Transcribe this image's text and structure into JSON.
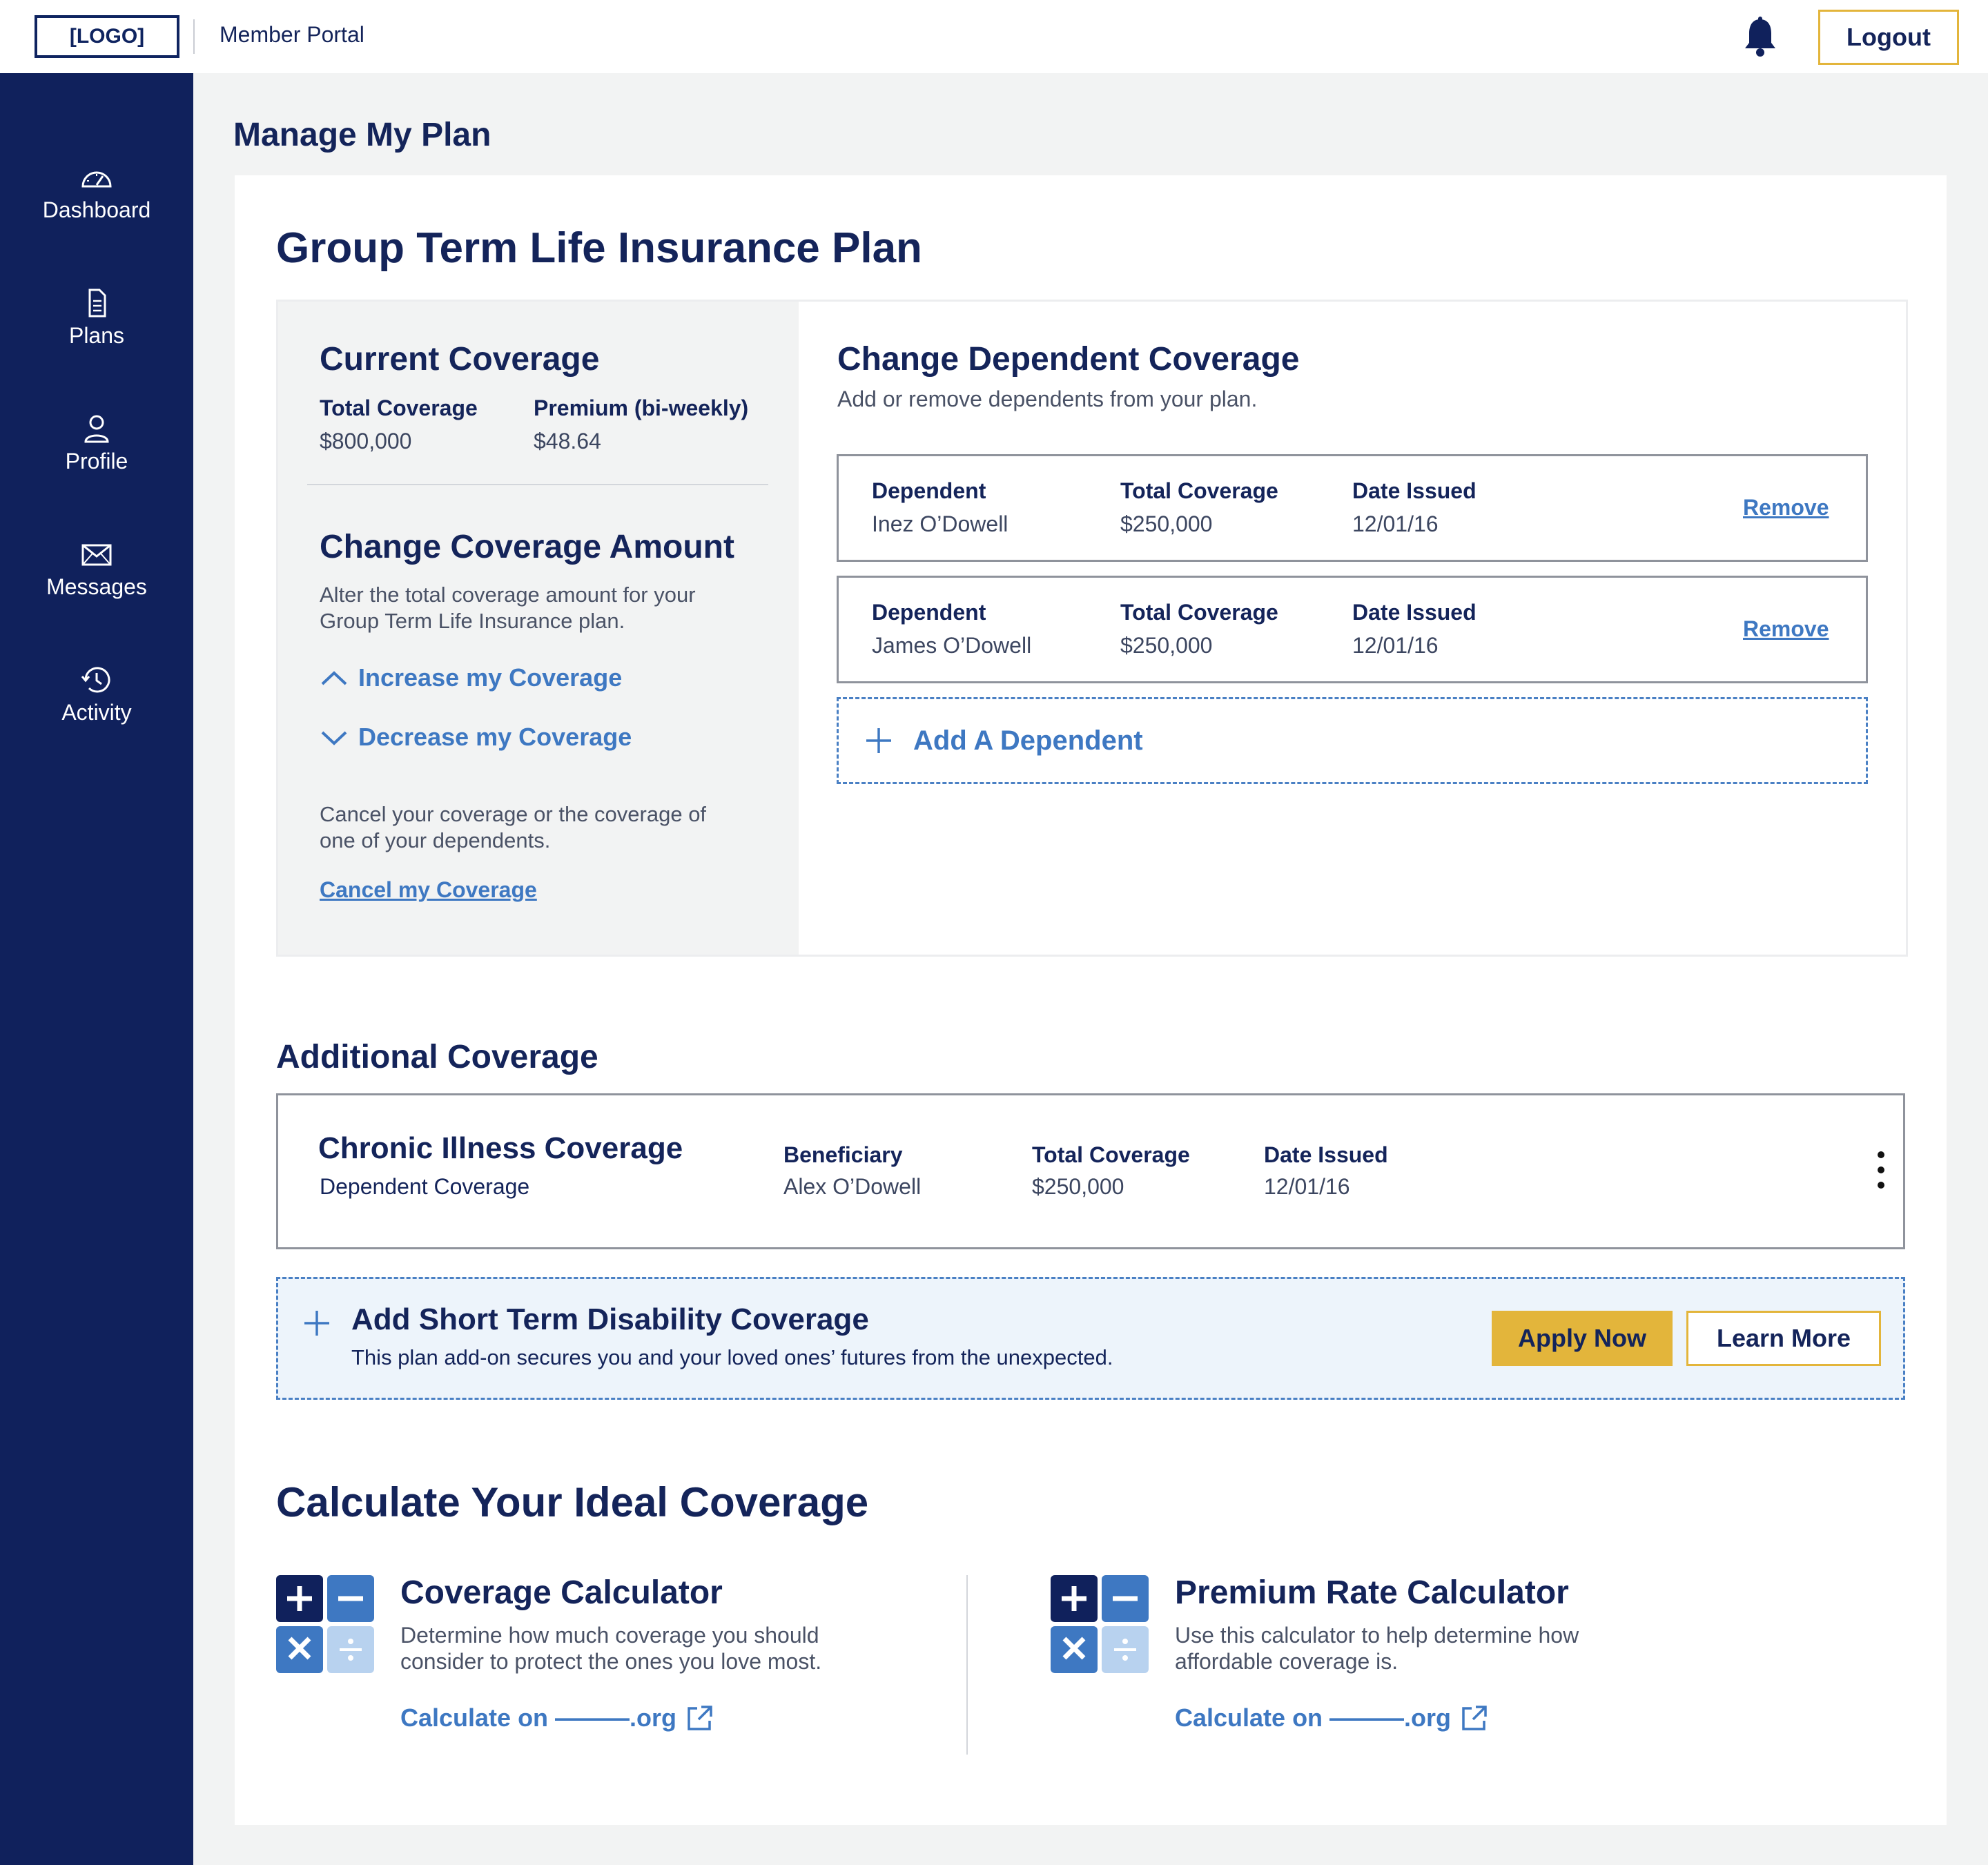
{
  "header": {
    "logo_text": "[LOGO]",
    "portal_name": "Member Portal",
    "logout_label": "Logout",
    "bell_icon": "bell-icon"
  },
  "sidebar": {
    "items": [
      {
        "label": "Dashboard",
        "icon": "speedometer-icon"
      },
      {
        "label": "Plans",
        "icon": "document-icon"
      },
      {
        "label": "Profile",
        "icon": "user-icon"
      },
      {
        "label": "Messages",
        "icon": "envelope-icon"
      },
      {
        "label": "Activity",
        "icon": "history-icon"
      }
    ]
  },
  "page": {
    "title": "Manage My Plan",
    "plan_title": "Group Term Life Insurance Plan"
  },
  "current_coverage": {
    "heading": "Current Coverage",
    "total_label": "Total Coverage",
    "total_value": "$800,000",
    "premium_label": "Premium (bi-weekly)",
    "premium_value": "$48.64"
  },
  "change_amount": {
    "heading": "Change Coverage Amount",
    "description_line1": "Alter the total coverage amount for your",
    "description_line2": "Group Term Life Insurance plan.",
    "increase_label": "Increase my Coverage",
    "decrease_label": "Decrease my Coverage",
    "cancel_text_line1": "Cancel your coverage or the coverage of",
    "cancel_text_line2": "one of your dependents.",
    "cancel_link": "Cancel my Coverage"
  },
  "dependents": {
    "heading": "Change Dependent Coverage",
    "subtitle": "Add or remove dependents from your plan.",
    "col_dependent": "Dependent",
    "col_total": "Total Coverage",
    "col_date": "Date Issued",
    "remove_label": "Remove",
    "rows": [
      {
        "name": "Inez O’Dowell",
        "total": "$250,000",
        "date": "12/01/16"
      },
      {
        "name": "James O’Dowell",
        "total": "$250,000",
        "date": "12/01/16"
      }
    ],
    "add_label": "Add A Dependent"
  },
  "additional": {
    "heading": "Additional Coverage",
    "chronic": {
      "title": "Chronic Illness Coverage",
      "subtitle": "Dependent Coverage",
      "beneficiary_label": "Beneficiary",
      "beneficiary_value": "Alex O’Dowell",
      "total_label": "Total Coverage",
      "total_value": "$250,000",
      "date_label": "Date Issued",
      "date_value": "12/01/16"
    },
    "std": {
      "title": "Add Short Term Disability Coverage",
      "description": "This plan add-on secures you and your loved ones’ futures from the unexpected.",
      "apply_label": "Apply Now",
      "learn_label": "Learn More"
    }
  },
  "calculators": {
    "heading": "Calculate Your Ideal Coverage",
    "items": [
      {
        "title": "Coverage Calculator",
        "desc_line1": "Determine how much coverage you should",
        "desc_line2": "consider to protect the ones you love most.",
        "link": "Calculate on ———.org"
      },
      {
        "title": "Premium Rate Calculator",
        "desc_line1": "Use this calculator to help determine how",
        "desc_line2": "affordable coverage is.",
        "link": "Calculate on ———.org"
      }
    ]
  },
  "colors": {
    "navy": "#10215c",
    "accent_blue": "#3e78c2",
    "gold": "#e3b53b",
    "light_blue_bg": "#edf4fb"
  }
}
